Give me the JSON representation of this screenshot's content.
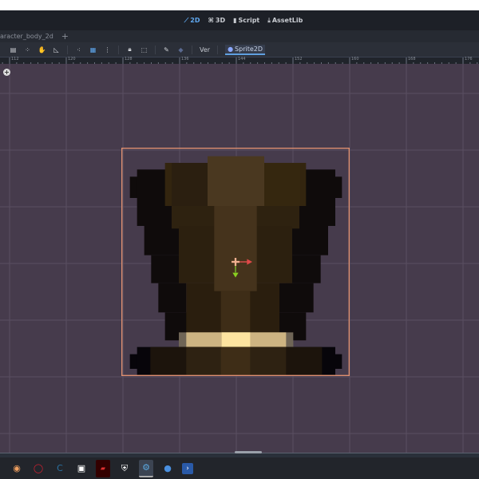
{
  "header": {
    "buttons": [
      {
        "label": "2D",
        "icon": "2d-icon",
        "active": true
      },
      {
        "label": "3D",
        "icon": "3d-icon"
      },
      {
        "label": "Script",
        "icon": "script-icon"
      },
      {
        "label": "AssetLib",
        "icon": "assetlib-icon"
      }
    ]
  },
  "tabs": {
    "scene_tab": "aracter_body_2d",
    "add": "+"
  },
  "toolbar": {
    "view_label": "Ver",
    "node_label": "Sprite2D"
  },
  "ruler": {
    "labels": [
      "112",
      "120",
      "128",
      "136",
      "144",
      "152",
      "160",
      "168",
      "176"
    ]
  },
  "colors": {
    "canvas": "#463b4c",
    "accent": "#5fa8f0",
    "selection": "#e09070"
  },
  "taskbar": {
    "apps": [
      "media-player-icon",
      "opera-icon",
      "app-c-icon",
      "app-square-icon",
      "app-red-icon",
      "shield-app-icon",
      "godot-icon",
      "app-blue-circle-icon",
      "powershell-icon"
    ]
  }
}
